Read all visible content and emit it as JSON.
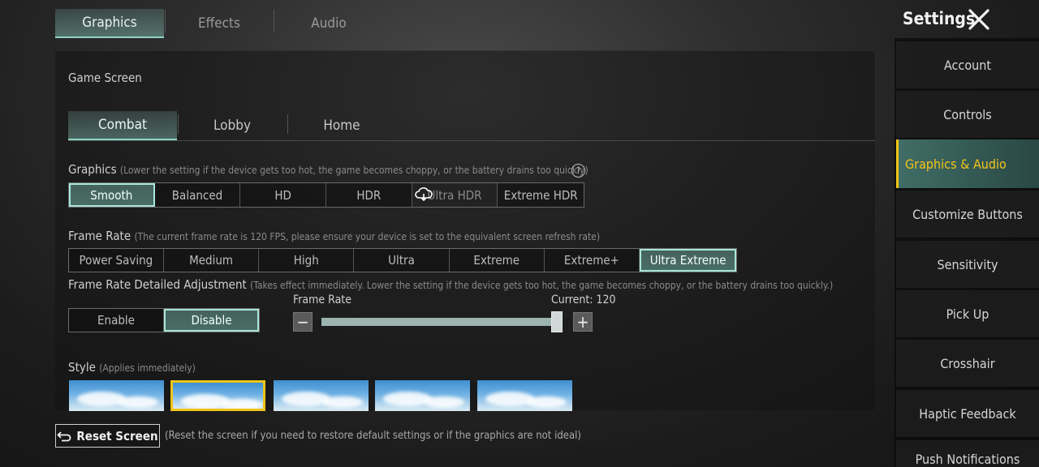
{
  "top_tabs": [
    {
      "label": "Graphics",
      "active": true
    },
    {
      "label": "Effects",
      "active": false
    },
    {
      "label": "Audio",
      "active": false
    }
  ],
  "header": {
    "title": "Settings"
  },
  "section_title": "Game Screen",
  "sub_tabs": [
    {
      "label": "Combat",
      "active": true
    },
    {
      "label": "Lobby",
      "active": false
    },
    {
      "label": "Home",
      "active": false
    }
  ],
  "graphics": {
    "label": "Graphics",
    "hint": "(Lower the setting if the device gets too hot, the game becomes choppy, or the battery drains too quickly)",
    "help_glyph": "?",
    "options": [
      "Smooth",
      "Balanced",
      "HD",
      "HDR",
      "Ultra HDR",
      "Extreme HDR"
    ],
    "selected": "Smooth"
  },
  "frame_rate": {
    "label": "Frame Rate",
    "hint": "(The current frame rate is 120 FPS, please ensure your device is set to the equivalent screen refresh rate)",
    "options": [
      "Power Saving",
      "Medium",
      "High",
      "Ultra",
      "Extreme",
      "Extreme+",
      "Ultra Extreme"
    ],
    "selected": "Ultra Extreme"
  },
  "frame_rate_adjust": {
    "label": "Frame Rate Detailed Adjustment",
    "hint": "(Takes effect immediately. Lower the setting if the device gets too hot, the game becomes choppy, or the battery drains too quickly.)",
    "options": [
      "Enable",
      "Disable"
    ],
    "selected": "Disable",
    "slider_label": "Frame Rate",
    "current_text": "Current: 120",
    "slider_level": 0.98,
    "minus_glyph": "−",
    "plus_glyph": "+"
  },
  "style": {
    "label": "Style",
    "hint": "(Applies immediately)",
    "thumbnail_count": 5,
    "selected_index": 1
  },
  "reset": {
    "label": "Reset Screen",
    "hint": "(Reset the screen if you need to restore default settings or if the graphics are not ideal)"
  },
  "sidebar": {
    "items": [
      {
        "label": "Account",
        "active": false
      },
      {
        "label": "Controls",
        "active": false
      },
      {
        "label": "Graphics & Audio",
        "active": true
      },
      {
        "label": "Customize Buttons",
        "active": false
      },
      {
        "label": "Sensitivity",
        "active": false
      },
      {
        "label": "Pick Up",
        "active": false
      },
      {
        "label": "Crosshair",
        "active": false
      },
      {
        "label": "Haptic Feedback",
        "active": false
      },
      {
        "label": "Push Notifications",
        "active": false
      }
    ]
  },
  "colors": {
    "accent_teal": "#8fd3c4",
    "active_sidebar_text": "#f5c518",
    "selected_thumbnail_border": "#f0c419"
  },
  "icons": {
    "close": "close-icon",
    "help": "question-circle-icon",
    "reset": "undo-arrow-icon",
    "cloud": "cloud-icon"
  }
}
